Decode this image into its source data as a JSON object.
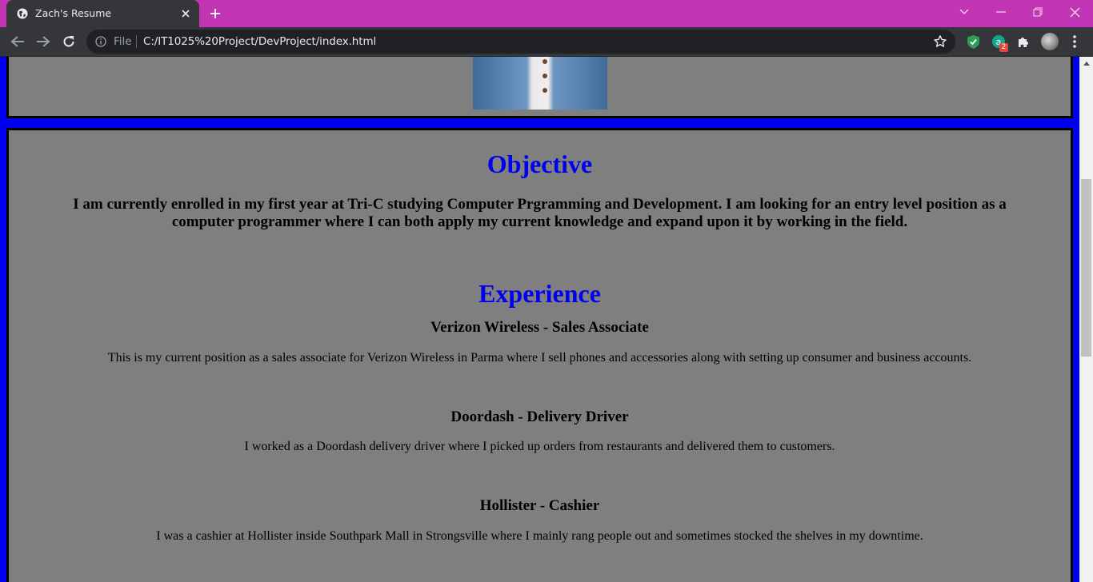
{
  "browser": {
    "tab_title": "Zach's Resume",
    "file_label": "File",
    "url": "C:/IT1025%20Project/DevProject/index.html",
    "extension_badge": "2",
    "colors": {
      "tabstrip": "#c236b6",
      "toolbar": "#35363a"
    }
  },
  "page": {
    "objective_heading": "Objective",
    "objective_text": "I am currently enrolled in my first year at Tri-C studying Computer Prgramming and Development. I am looking for an entry level position as a computer programmer where I can both apply my current knowledge and expand upon it by working in the field.",
    "experience_heading": "Experience",
    "jobs": [
      {
        "title": "Verizon Wireless - Sales Associate",
        "description": "This is my current position as a sales associate for Verizon Wireless in Parma where I sell phones and accessories along with setting up consumer and business accounts."
      },
      {
        "title": "Doordash - Delivery Driver",
        "description": "I worked as a Doordash delivery driver where I picked up orders from restaurants and delivered them to customers."
      },
      {
        "title": "Hollister - Cashier",
        "description": "I was a cashier at Hollister inside Southpark Mall in Strongsville where I mainly rang people out and sometimes stocked the shelves in my downtime."
      }
    ],
    "colors": {
      "heading": "#0000f0",
      "background": "#7f7f7f",
      "frame": "#0000f0"
    }
  }
}
